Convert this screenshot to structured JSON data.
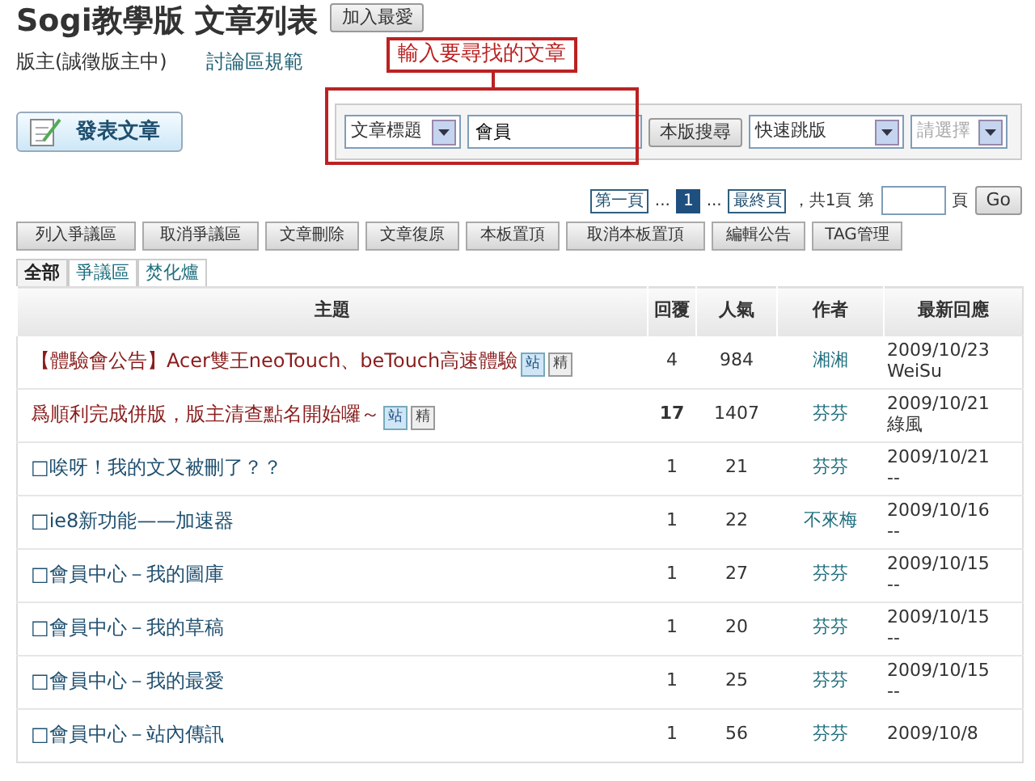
{
  "header": {
    "title": "Sogi教學版 文章列表",
    "favorite_button": "加入最愛",
    "moderator": "版主(誠徵版主中)",
    "rules_link": "討論區規範"
  },
  "annotation": {
    "text": "輸入要尋找的文章"
  },
  "post_button": "發表文章",
  "search": {
    "field_select": "文章標題",
    "query": "會員",
    "search_button": "本版搜尋",
    "jump_select": "快速跳版",
    "sub_select": "請選擇"
  },
  "pagination": {
    "first": "第一頁",
    "ellipsis_left": "...",
    "pages": [
      {
        "label": "1",
        "selected": true
      }
    ],
    "ellipsis_right": "...",
    "last": "最終頁",
    "total": "，共1頁",
    "goto_prefix": "第",
    "goto_suffix": "頁",
    "go_button": "Go"
  },
  "admin_buttons": [
    "列入爭議區",
    "取消爭議區",
    "文章刪除",
    "文章復原",
    "本板置頂",
    "取消本板置頂",
    "編輯公告",
    "TAG管理"
  ],
  "tabs": [
    {
      "label": "全部",
      "selected": true
    },
    {
      "label": "爭議區",
      "selected": false
    },
    {
      "label": "焚化爐",
      "selected": false
    }
  ],
  "table": {
    "columns": [
      "主題",
      "回覆",
      "人氣",
      "作者",
      "最新回應"
    ],
    "rows": [
      {
        "kind": "notice",
        "title": "【體驗會公告】Acer雙王neoTouch、beTouch高速體驗",
        "badges": [
          {
            "kind": "site",
            "label": "站"
          },
          {
            "kind": "elite",
            "label": "精"
          }
        ],
        "replies": "4",
        "hot": false,
        "views": "984",
        "author": "湘湘",
        "last_date": "2009/10/23",
        "last_user": "WeiSu"
      },
      {
        "kind": "notice",
        "title": "爲順利完成併版，版主清查點名開始囉～",
        "badges": [
          {
            "kind": "site",
            "label": "站"
          },
          {
            "kind": "elite",
            "label": "精"
          }
        ],
        "replies": "17",
        "hot": true,
        "views": "1407",
        "author": "芬芬",
        "last_date": "2009/10/21",
        "last_user": "綠風"
      },
      {
        "kind": "normal",
        "title": "□唉呀！我的文又被刪了？？",
        "badges": [],
        "replies": "1",
        "hot": false,
        "views": "21",
        "author": "芬芬",
        "last_date": "2009/10/21",
        "last_user": "--"
      },
      {
        "kind": "normal",
        "title": "□ie8新功能——加速器",
        "badges": [],
        "replies": "1",
        "hot": false,
        "views": "22",
        "author": "不來梅",
        "last_date": "2009/10/16",
        "last_user": "--"
      },
      {
        "kind": "normal",
        "title": "□會員中心－我的圖庫",
        "badges": [],
        "replies": "1",
        "hot": false,
        "views": "27",
        "author": "芬芬",
        "last_date": "2009/10/15",
        "last_user": "--"
      },
      {
        "kind": "normal",
        "title": "□會員中心－我的草稿",
        "badges": [],
        "replies": "1",
        "hot": false,
        "views": "20",
        "author": "芬芬",
        "last_date": "2009/10/15",
        "last_user": "--"
      },
      {
        "kind": "normal",
        "title": "□會員中心－我的最愛",
        "badges": [],
        "replies": "1",
        "hot": false,
        "views": "25",
        "author": "芬芬",
        "last_date": "2009/10/15",
        "last_user": "--"
      },
      {
        "kind": "normal",
        "title": "□會員中心－站內傳訊",
        "badges": [],
        "replies": "1",
        "hot": false,
        "views": "56",
        "author": "芬芬",
        "last_date": "2009/10/8"
      }
    ]
  }
}
